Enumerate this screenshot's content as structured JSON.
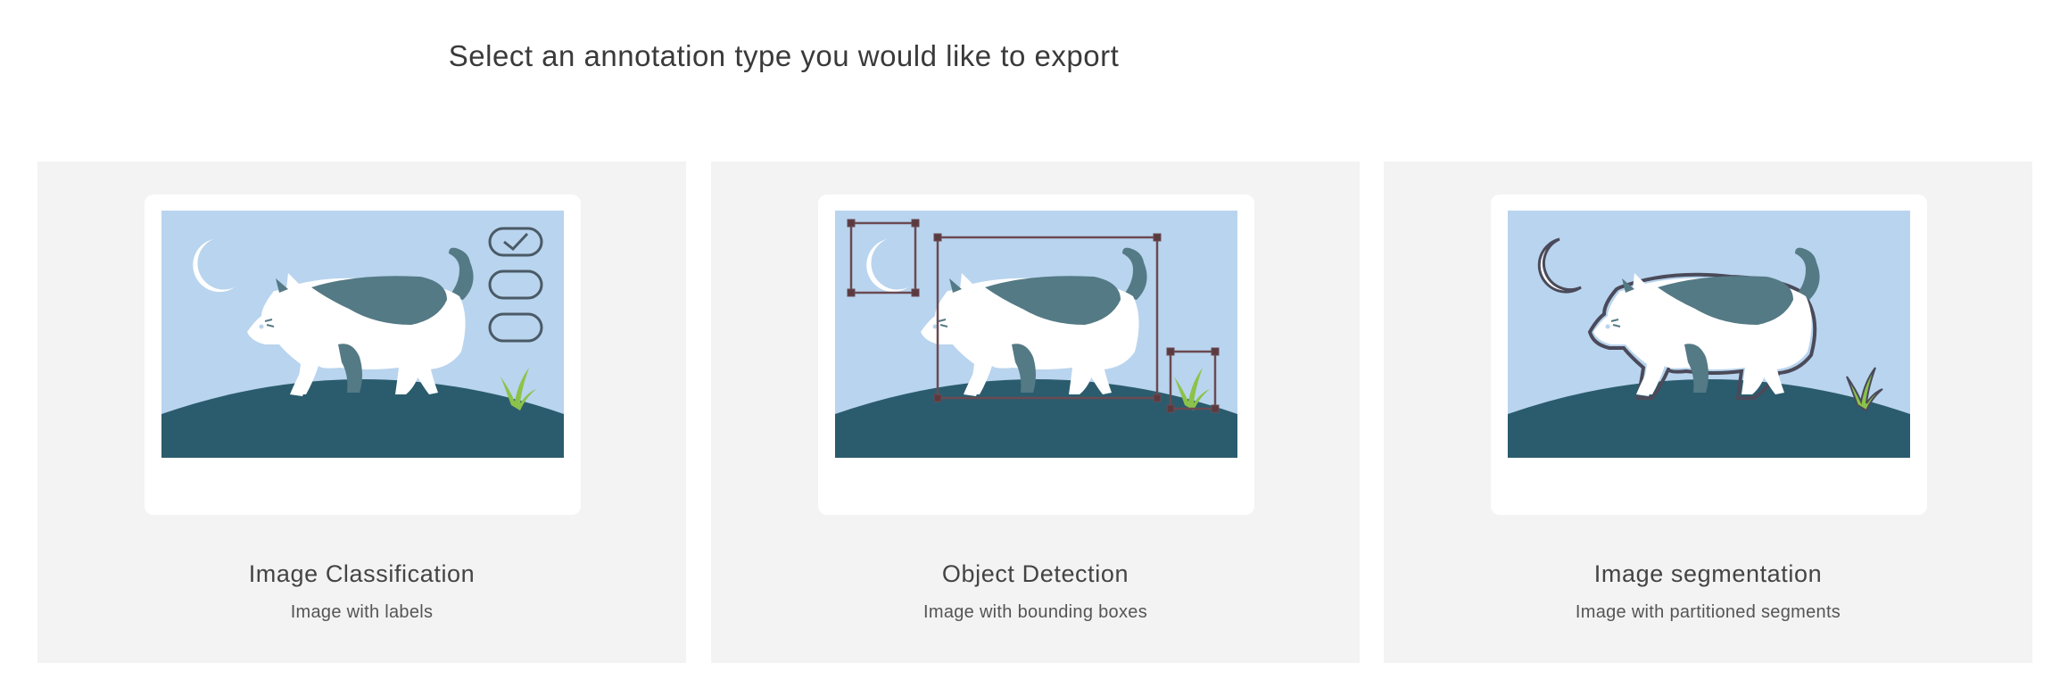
{
  "header": {
    "title": "Select an annotation type you would like to export"
  },
  "colors": {
    "sky": "#b9d4ee",
    "hill": "#2b5c6e",
    "cat_patch": "#547a85",
    "grass": "#8bc34a",
    "box": "#5a3a40",
    "card_bg": "#f3f3f3"
  },
  "options": [
    {
      "title": "Image Classification",
      "subtitle": "Image with labels",
      "illustration": "classification-illustration"
    },
    {
      "title": "Object Detection",
      "subtitle": "Image with bounding boxes",
      "illustration": "object-detection-illustration"
    },
    {
      "title": "Image segmentation",
      "subtitle": "Image with partitioned segments",
      "illustration": "segmentation-illustration"
    }
  ]
}
